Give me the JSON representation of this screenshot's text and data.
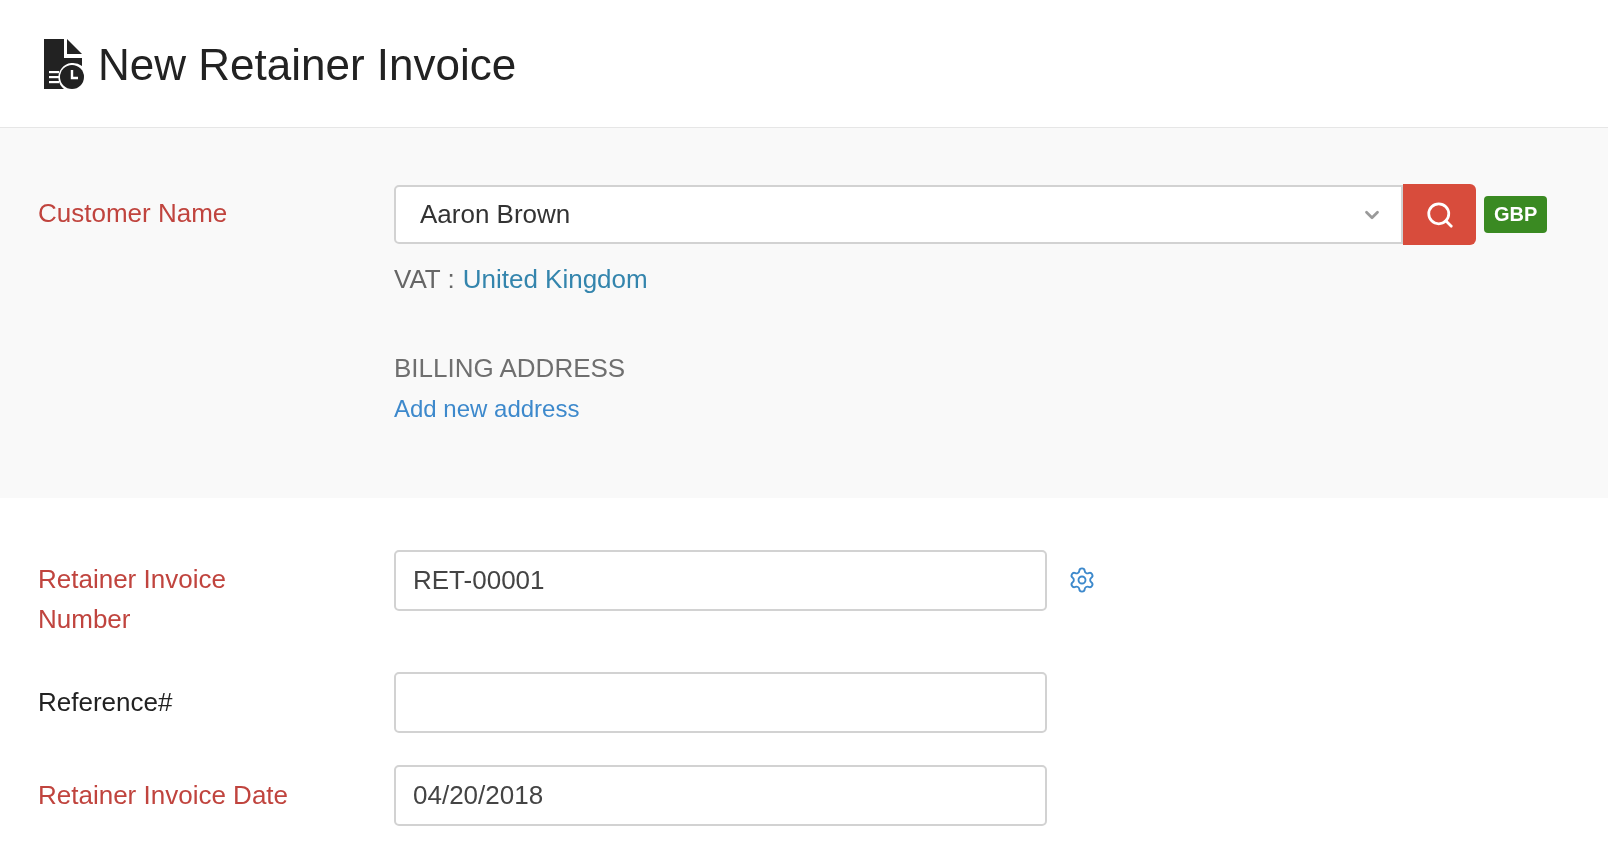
{
  "header": {
    "title": "New Retainer Invoice"
  },
  "customer": {
    "label": "Customer Name",
    "required": true,
    "value": "Aaron Brown",
    "currency": "GBP",
    "vat_label": "VAT :",
    "vat_country": "United Kingdom"
  },
  "billing_address": {
    "heading": "BILLING ADDRESS",
    "link": "Add new address"
  },
  "fields": [
    {
      "kind": "settings",
      "label": "Retainer Invoice Number",
      "required": true,
      "value": "RET-00001"
    },
    {
      "kind": "text",
      "label": "Reference#",
      "required": false
    },
    {
      "kind": "date",
      "label": "Retainer Invoice Date",
      "required": true,
      "value": "04/20/2018"
    }
  ]
}
